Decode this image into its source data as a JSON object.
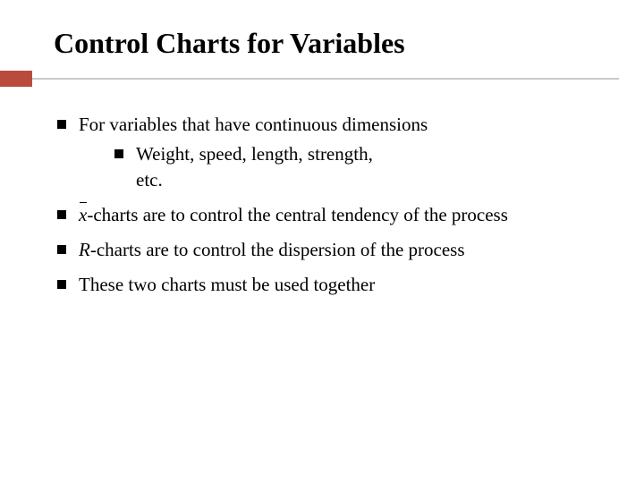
{
  "title": "Control Charts for Variables",
  "bullets": {
    "b1": "For variables that have continuous dimensions",
    "b1_sub1": "Weight, speed, length, strength, etc.",
    "b2_prefix": "x",
    "b2_rest": "-charts are to control the central tendency of the process",
    "b3_prefix": "R",
    "b3_rest": "-charts are to control the dispersion of the process",
    "b4": "These two charts must be used together"
  }
}
